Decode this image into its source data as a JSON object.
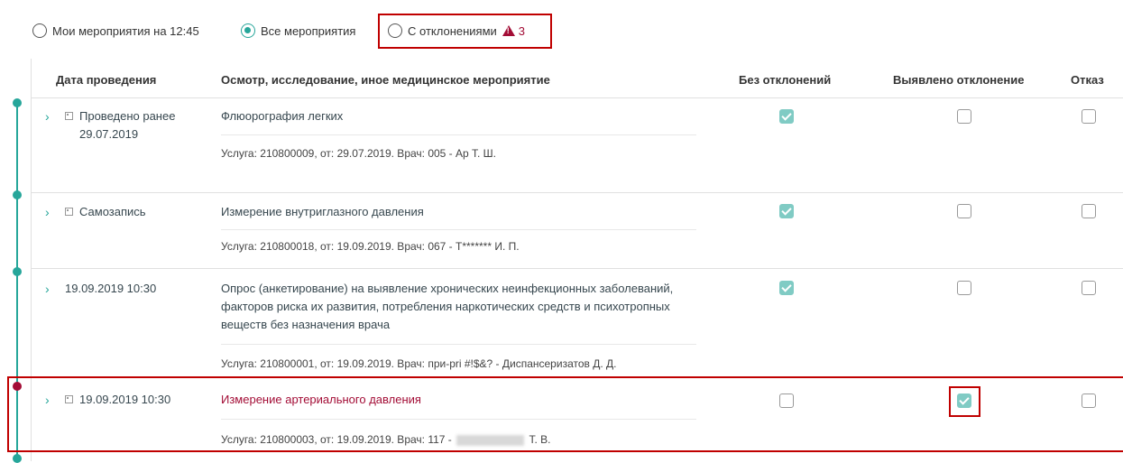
{
  "filters": {
    "my_events_label": "Мои мероприятия на 12:45",
    "all_events_label": "Все мероприятия",
    "with_deviations_label": "С отклонениями",
    "deviation_count": "3",
    "selected": "all"
  },
  "columns": {
    "date": "Дата проведения",
    "exam": "Осмотр, исследование, иное медицинское мероприятие",
    "no_deviation": "Без отклонений",
    "deviation_found": "Выявлено отклонение",
    "refusal": "Отказ"
  },
  "rows": [
    {
      "date": "Проведено ранее 29.07.2019",
      "title": "Флюорография легких",
      "service": "Услуга: 210800009, от: 29.07.2019. Врач: 005 - Ар Т. Ш.",
      "no_deviation": true,
      "deviation_found": false,
      "refusal": false
    },
    {
      "date": "Самозапись",
      "title": "Измерение внутриглазного давления",
      "service": "Услуга: 210800018, от: 19.09.2019. Врач: 067 - Т******* И. П.",
      "no_deviation": true,
      "deviation_found": false,
      "refusal": false
    },
    {
      "date": "19.09.2019 10:30",
      "title": "Опрос (анкетирование) на выявление хронических неинфекционных заболеваний, факторов риска их развития, потребления наркотических средств и психотропных веществ без назначения врача",
      "service": "Услуга: 210800001, от: 19.09.2019. Врач: при-pri #!$&? - Диспансеризатов Д. Д.",
      "no_deviation": true,
      "deviation_found": false,
      "refusal": false
    },
    {
      "date": "19.09.2019 10:30",
      "title": "Измерение артериального давления",
      "service_prefix": "Услуга: 210800003, от: 19.09.2019. Врач: 117 -",
      "service_suffix": "Т. В.",
      "no_deviation": false,
      "deviation_found": true,
      "refusal": false
    }
  ],
  "colors": {
    "accent": "#26a69a",
    "deviation": "#a30d36",
    "highlight_border": "#c00000"
  }
}
